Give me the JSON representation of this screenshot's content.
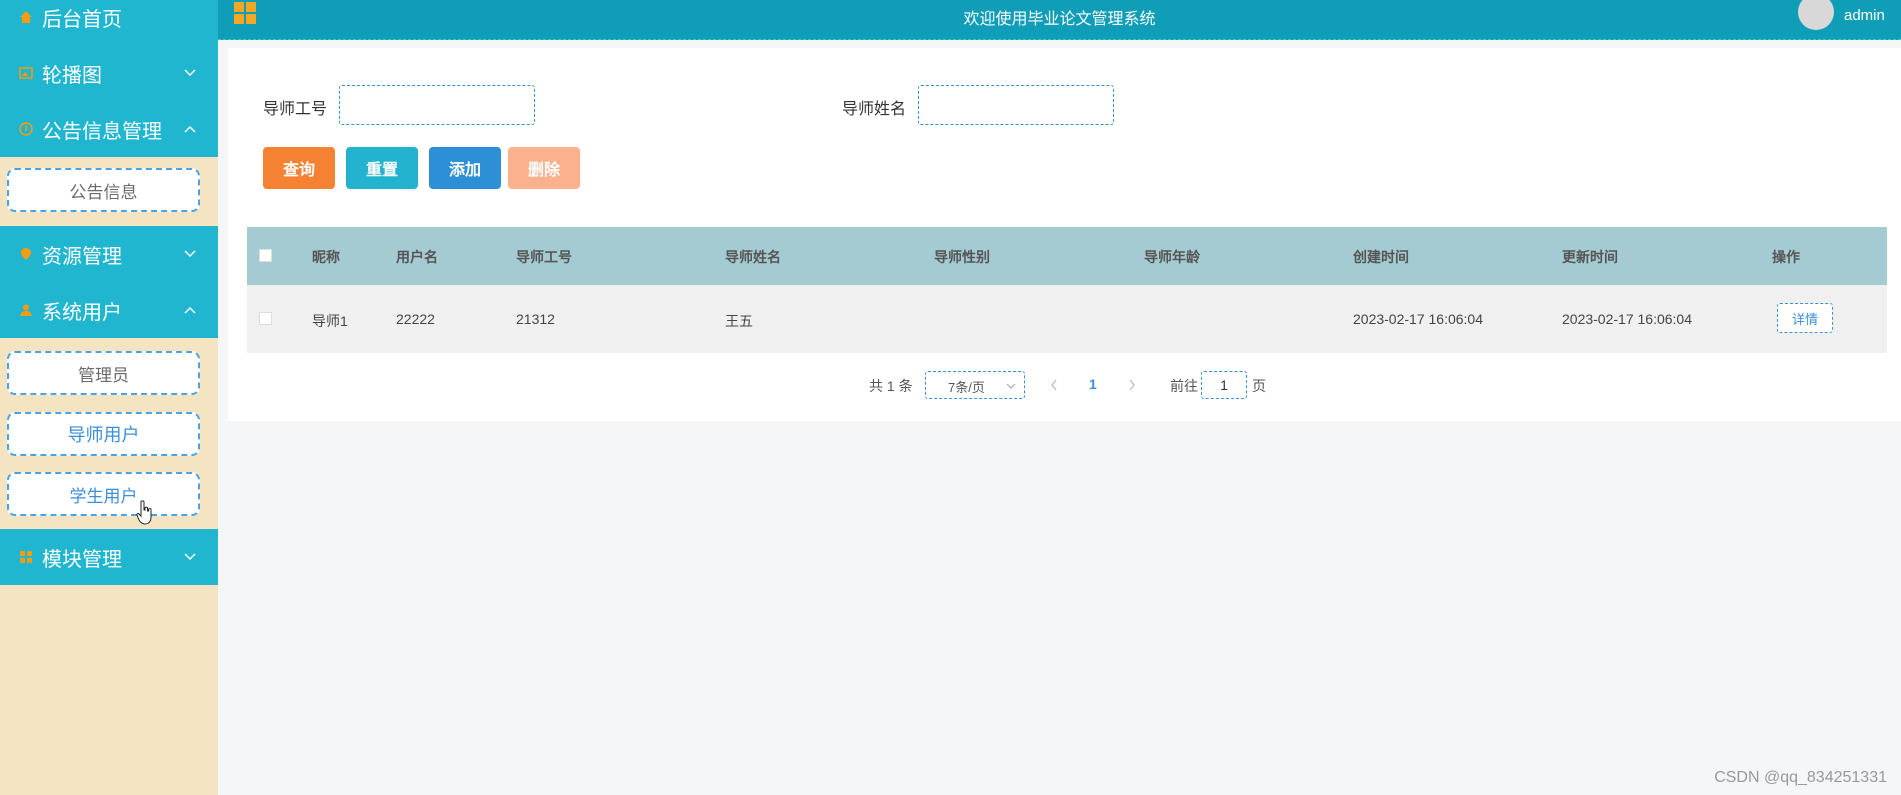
{
  "header": {
    "title": "欢迎使用毕业论文管理系统",
    "user": "admin"
  },
  "sidebar": {
    "home": "后台首页",
    "carousel": "轮播图",
    "notice_mgmt": "公告信息管理",
    "notice_info": "公告信息",
    "resource_mgmt": "资源管理",
    "system_users": "系统用户",
    "admin": "管理员",
    "tutor_users": "导师用户",
    "student_users": "学生用户",
    "module_mgmt": "模块管理"
  },
  "search": {
    "tutor_id_label": "导师工号",
    "tutor_name_label": "导师姓名",
    "tutor_id_value": "",
    "tutor_name_value": ""
  },
  "buttons": {
    "query": "查询",
    "reset": "重置",
    "add": "添加",
    "delete": "删除"
  },
  "table": {
    "headers": [
      "昵称",
      "用户名",
      "导师工号",
      "导师姓名",
      "导师性别",
      "导师年龄",
      "创建时间",
      "更新时间",
      "操作"
    ],
    "rows": [
      {
        "nickname": "导师1",
        "username": "22222",
        "tutor_id": "21312",
        "tutor_name": "王五",
        "gender": "",
        "age": "",
        "created": "2023-02-17 16:06:04",
        "updated": "2023-02-17 16:06:04",
        "action": "详情"
      }
    ]
  },
  "pagination": {
    "total": "共 1 条",
    "page_size": "7条/页",
    "current": "1",
    "goto_label": "前往",
    "goto_value": "1",
    "page_suffix": "页"
  },
  "watermark": "CSDN @qq_834251331",
  "colors": {
    "sidebar_bg": "#f5e4c2",
    "menu_bg": "#21b6d0",
    "header_bg": "#0f9db8",
    "query": "#f58233",
    "reset": "#23b3cf",
    "add": "#2d8fd5",
    "delete": "#fbb18e"
  }
}
